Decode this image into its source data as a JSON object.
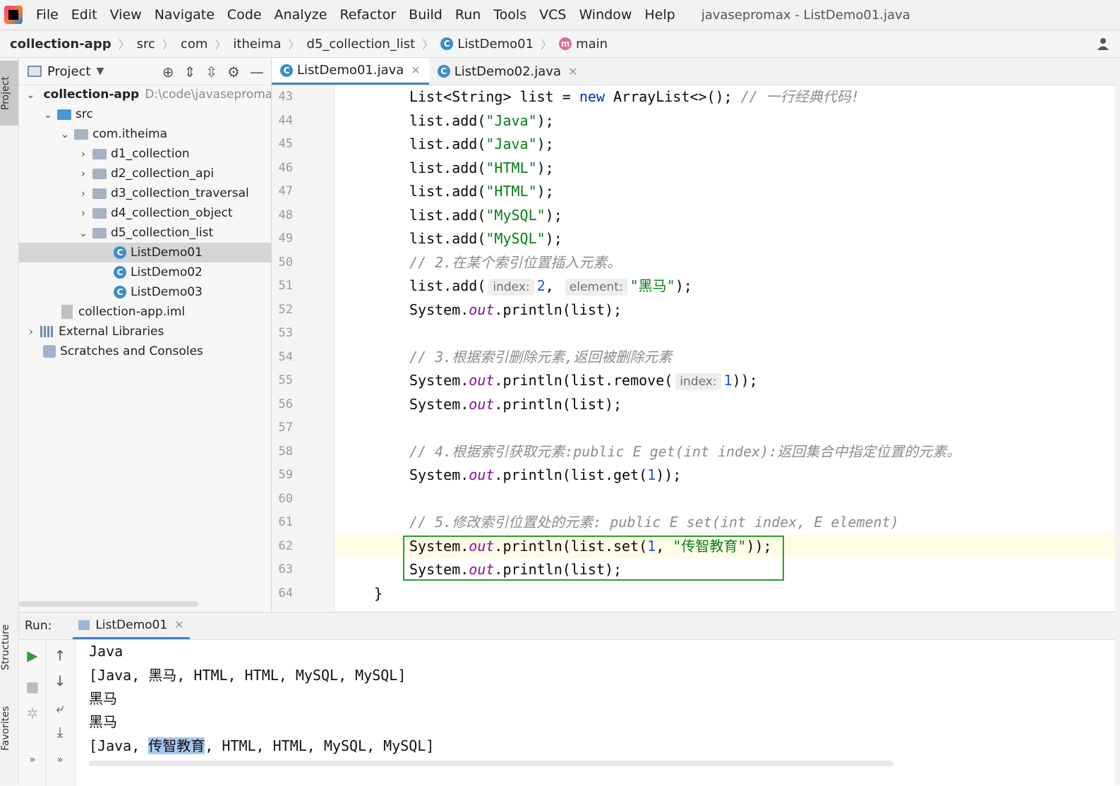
{
  "menubar": {
    "items": [
      "File",
      "Edit",
      "View",
      "Navigate",
      "Code",
      "Analyze",
      "Refactor",
      "Build",
      "Run",
      "Tools",
      "VCS",
      "Window",
      "Help"
    ],
    "window_title": "javasepromax - ListDemo01.java"
  },
  "breadcrumb": [
    "collection-app",
    "src",
    "com",
    "itheima",
    "d5_collection_list",
    "ListDemo01",
    "main"
  ],
  "left_stripe": {
    "project": "Project",
    "structure": "Structure",
    "favorites": "Favorites"
  },
  "project_panel": {
    "title": "Project",
    "root": {
      "name": "collection-app",
      "path": "D:\\code\\javasepromax"
    },
    "src": "src",
    "package": "com.itheima",
    "folders": [
      "d1_collection",
      "d2_collection_api",
      "d3_collection_traversal",
      "d4_collection_object",
      "d5_collection_list"
    ],
    "files": [
      "ListDemo01",
      "ListDemo02",
      "ListDemo03"
    ],
    "iml": "collection-app.iml",
    "external_libraries": "External Libraries",
    "scratches": "Scratches and Consoles"
  },
  "editor_tabs": [
    {
      "label": "ListDemo01.java",
      "active": true
    },
    {
      "label": "ListDemo02.java",
      "active": false
    }
  ],
  "editor": {
    "line_numbers": [
      "43",
      "44",
      "45",
      "46",
      "47",
      "48",
      "49",
      "50",
      "51",
      "52",
      "53",
      "54",
      "55",
      "56",
      "57",
      "58",
      "59",
      "60",
      "61",
      "62",
      "63",
      "64"
    ],
    "lines": {
      "l43_a": "List<String> list = ",
      "l43_kw": "new",
      "l43_b": " ArrayList<>(); ",
      "l43_c": "// 一行经典代码!",
      "l44_a": "list.add(",
      "l44_s": "\"Java\"",
      "l44_b": ");",
      "l45_a": "list.add(",
      "l45_s": "\"Java\"",
      "l45_b": ");",
      "l46_a": "list.add(",
      "l46_s": "\"HTML\"",
      "l46_b": ");",
      "l47_a": "list.add(",
      "l47_s": "\"HTML\"",
      "l47_b": ");",
      "l48_a": "list.add(",
      "l48_s": "\"MySQL\"",
      "l48_b": ");",
      "l49_a": "list.add(",
      "l49_s": "\"MySQL\"",
      "l49_b": ");",
      "l50_c": "// 2.在某个索引位置插入元素。",
      "l51_a": "list.add(",
      "l51_h1": "index:",
      "l51_n": "2",
      "l51_comma": ",",
      "l51_h2": "element:",
      "l51_s": "\"黑马\"",
      "l51_b": ");",
      "l52_a": "System.",
      "l52_f": "out",
      "l52_b": ".println(list);",
      "l54_c": "// 3.根据索引删除元素,返回被删除元素",
      "l55_a": "System.",
      "l55_f": "out",
      "l55_b": ".println(list.remove(",
      "l55_h": "index:",
      "l55_n": "1",
      "l55_e": "));",
      "l56_a": "System.",
      "l56_f": "out",
      "l56_b": ".println(list);",
      "l58_c": "// 4.根据索引获取元素:public E get(int index):返回集合中指定位置的元素。",
      "l59_a": "System.",
      "l59_f": "out",
      "l59_b": ".println(list.get(",
      "l59_n": "1",
      "l59_e": "));",
      "l61_c": "// 5.修改索引位置处的元素: public E set(int index, E element)",
      "l62_a": "System.",
      "l62_f": "out",
      "l62_b": ".println(list.set(",
      "l62_n": "1",
      "l62_comma": ", ",
      "l62_s": "\"传智教育\"",
      "l62_e": "));",
      "l63_a": "System.",
      "l63_f": "out",
      "l63_b": ".println(list);",
      "l64": "}"
    }
  },
  "run_panel": {
    "label": "Run:",
    "tab": "ListDemo01",
    "output": [
      "Java",
      "[Java, 黑马, HTML, HTML, MySQL, MySQL]",
      "黑马",
      "黑马"
    ],
    "last_line": {
      "prefix": "[Java, ",
      "selected": "传智教育",
      "suffix": ", HTML, HTML, MySQL, MySQL]"
    }
  },
  "colors": {
    "keyword": "#0033b3",
    "string": "#067d17",
    "number": "#1750eb",
    "field": "#871094",
    "comment": "#8c8c8c",
    "highlight_box": "#2aa02a",
    "selection": "#a6c8f0"
  }
}
